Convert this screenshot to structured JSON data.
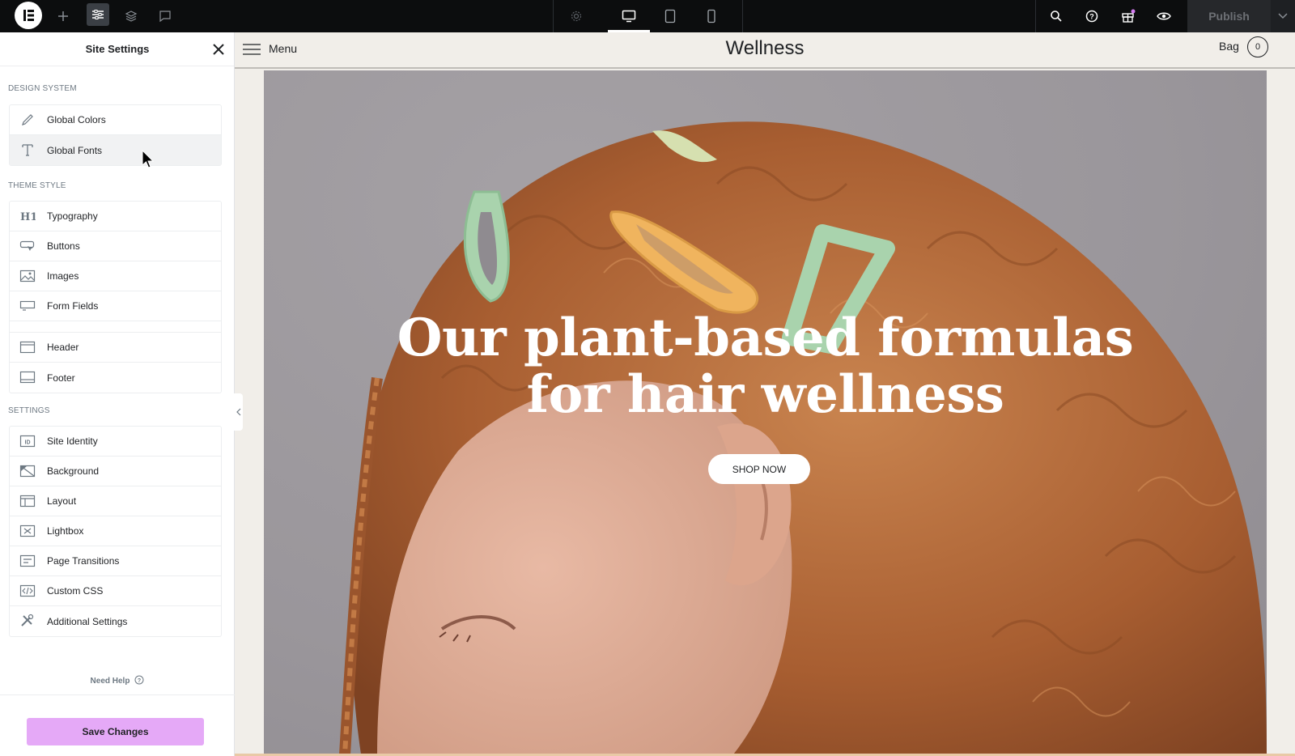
{
  "topbar": {
    "icons": [
      "elementor-logo-icon",
      "plus-icon",
      "site-settings-icon",
      "layers-icon",
      "comments-icon",
      "settings-gear-icon",
      "desktop-icon",
      "tablet-icon",
      "mobile-icon",
      "search-icon",
      "help-icon",
      "gift-icon",
      "preview-eye-icon",
      "chevron-down-icon"
    ],
    "publish_label": "Publish"
  },
  "panel": {
    "title": "Site Settings",
    "sections": [
      {
        "label": "DESIGN SYSTEM",
        "items": [
          {
            "label": "Global Colors",
            "icon": "brush-icon"
          },
          {
            "label": "Global Fonts",
            "icon": "font-t-icon"
          }
        ]
      },
      {
        "label": "THEME STYLE",
        "items": [
          {
            "label": "Typography",
            "icon": "h1-icon"
          },
          {
            "label": "Buttons",
            "icon": "button-icon"
          },
          {
            "label": "Images",
            "icon": "image-icon"
          },
          {
            "label": "Form Fields",
            "icon": "form-field-icon"
          },
          {
            "label": "Header",
            "icon": "header-icon"
          },
          {
            "label": "Footer",
            "icon": "footer-icon"
          }
        ]
      },
      {
        "label": "SETTINGS",
        "items": [
          {
            "label": "Site Identity",
            "icon": "site-identity-icon"
          },
          {
            "label": "Background",
            "icon": "background-icon"
          },
          {
            "label": "Layout",
            "icon": "layout-icon"
          },
          {
            "label": "Lightbox",
            "icon": "lightbox-icon"
          },
          {
            "label": "Page Transitions",
            "icon": "page-transitions-icon"
          },
          {
            "label": "Custom CSS",
            "icon": "custom-css-icon"
          },
          {
            "label": "Additional Settings",
            "icon": "tools-icon"
          }
        ]
      }
    ],
    "need_help": "Need Help",
    "save_label": "Save Changes"
  },
  "site": {
    "menu_label": "Menu",
    "brand": "Wellness",
    "bag_label": "Bag",
    "bag_count": "0",
    "hero_line1": "Our plant-based formulas",
    "hero_line2": "for hair wellness",
    "cta": "SHOP NOW"
  },
  "colors": {
    "topbar_bg": "#0c0d0e",
    "save_button": "#e5a9f7",
    "site_bg": "#f1eee9",
    "hair": "#b5693a",
    "clip_green": "#a9d3ad",
    "clip_orange": "#f0b45e"
  }
}
